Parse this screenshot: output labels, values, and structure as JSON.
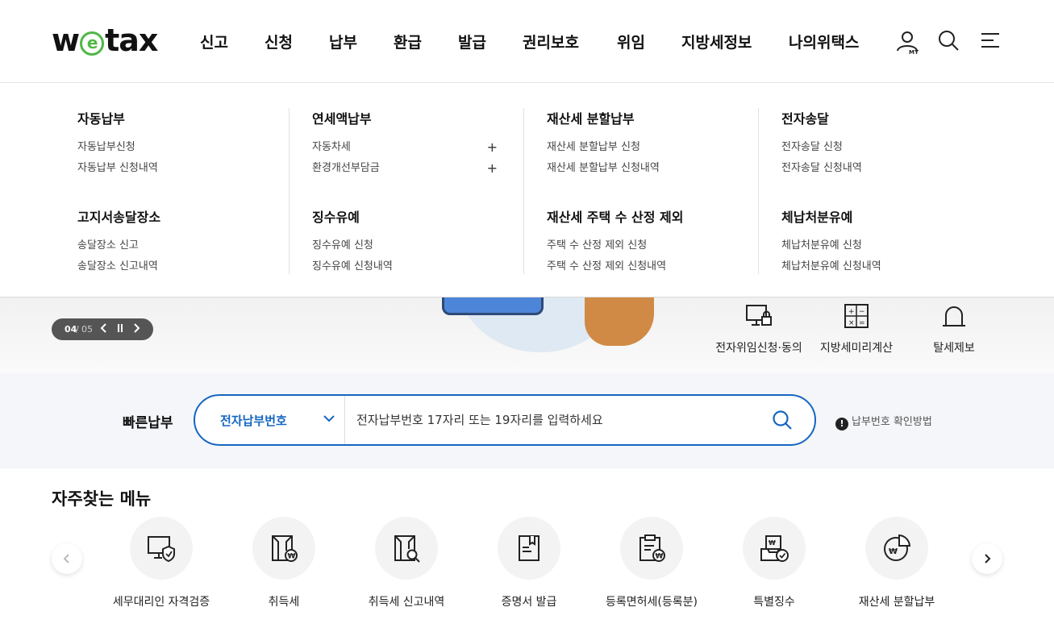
{
  "header": {
    "logo": {
      "w": "w",
      "e": "e",
      "tax": "tax"
    },
    "nav": [
      "신고",
      "신청",
      "납부",
      "환급",
      "발급",
      "권리보호",
      "위임",
      "지방세정보",
      "나의위택스"
    ],
    "icons": [
      "my-user-icon",
      "search-icon",
      "menu-icon"
    ],
    "my_label": "MY"
  },
  "mega_menu": {
    "columns": [
      {
        "groups": [
          {
            "title": "자동납부",
            "items": [
              {
                "label": "자동납부신청"
              },
              {
                "label": "자동납부 신청내역"
              }
            ]
          },
          {
            "title": "고지서송달장소",
            "items": [
              {
                "label": "송달장소 신고"
              },
              {
                "label": "송달장소 신고내역"
              }
            ]
          }
        ]
      },
      {
        "groups": [
          {
            "title": "연세액납부",
            "items": [
              {
                "label": "자동차세",
                "expand": "+"
              },
              {
                "label": "환경개선부담금",
                "expand": "+"
              }
            ]
          },
          {
            "title": "징수유예",
            "items": [
              {
                "label": "징수유예 신청"
              },
              {
                "label": "징수유예 신청내역"
              }
            ]
          }
        ]
      },
      {
        "groups": [
          {
            "title": "재산세 분할납부",
            "items": [
              {
                "label": "재산세 분할납부 신청"
              },
              {
                "label": "재산세 분할납부 신청내역"
              }
            ]
          },
          {
            "title": "재산세 주택 수 산정 제외",
            "items": [
              {
                "label": "주택 수 산정 제외 신청"
              },
              {
                "label": "주택 수 산정 제외 신청내역"
              }
            ]
          }
        ]
      },
      {
        "groups": [
          {
            "title": "전자송달",
            "items": [
              {
                "label": "전자송달 신청"
              },
              {
                "label": "전자송달 신청내역"
              }
            ]
          },
          {
            "title": "체납처분유예",
            "items": [
              {
                "label": "체납처분유예 신청"
              },
              {
                "label": "체납처분유예 신청내역"
              }
            ]
          }
        ]
      }
    ]
  },
  "hero": {
    "pager": {
      "current": "04",
      "separator": "/",
      "total": "05"
    },
    "quick_links": [
      {
        "label": "전자위임신청·동의",
        "icon": "monitor-lock-icon"
      },
      {
        "label": "지방세미리계산",
        "icon": "calculator-icon"
      },
      {
        "label": "탈세제보",
        "icon": "alarm-bell-icon"
      }
    ]
  },
  "quick_pay": {
    "title": "빠른납부",
    "select_value": "전자납부번호",
    "placeholder": "전자납부번호 17자리 또는 19자리를 입력하세요",
    "help": "납부번호 확인방법",
    "help_badge": "!"
  },
  "favorites": {
    "title": "자주찾는 메뉴",
    "items": [
      {
        "label": "세무대리인 자격검증",
        "icon": "monitor-shield-icon"
      },
      {
        "label": "취득세",
        "icon": "doc-won-icon"
      },
      {
        "label": "취득세 신고내역",
        "icon": "doc-search-icon"
      },
      {
        "label": "증명서 발급",
        "icon": "certificate-icon"
      },
      {
        "label": "등록면허세(등록분)",
        "icon": "clipboard-won-icon"
      },
      {
        "label": "특별징수",
        "icon": "tray-check-icon"
      },
      {
        "label": "재산세 분할납부",
        "icon": "pie-won-icon"
      }
    ]
  }
}
